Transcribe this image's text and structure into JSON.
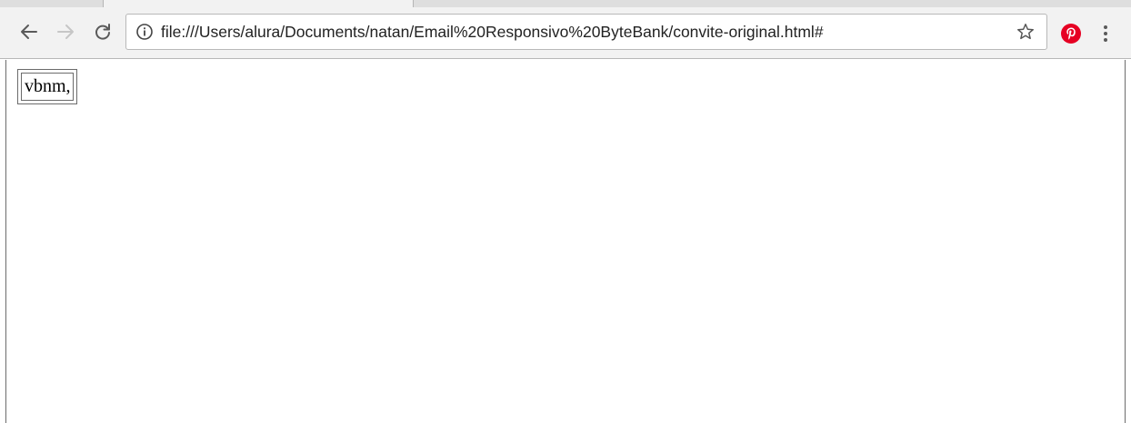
{
  "browser": {
    "toolbar": {
      "back_icon": "arrow-left-icon",
      "forward_icon": "arrow-right-icon",
      "reload_icon": "reload-icon",
      "menu_icon": "vertical-dots-icon"
    },
    "omnibox": {
      "security_icon": "info-circle-icon",
      "url": "file:///Users/alura/Documents/natan/Email%20Responsivo%20ByteBank/convite-original.html#",
      "bookmark_icon": "star-outline-icon"
    },
    "extensions": [
      {
        "name": "pinterest-icon",
        "color": "#e60023"
      }
    ]
  },
  "page": {
    "table": {
      "rows": [
        [
          "vbnm,"
        ]
      ]
    }
  },
  "colors": {
    "toolbar_bg": "#f2f2f2",
    "icon_gray": "#5a5a5a",
    "icon_disabled": "#c6c6c6",
    "pinterest_red": "#e60023"
  }
}
